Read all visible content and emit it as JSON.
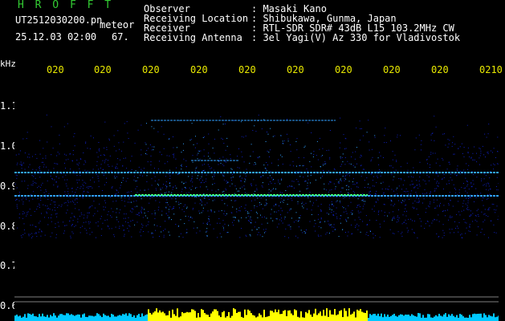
{
  "header": {
    "app_title": "H R O F F T",
    "file_name": "UT2512030200.pn",
    "overlay_label": "meteor",
    "timestamp": "25.12.03 02:00",
    "count": "67.",
    "fields": [
      {
        "label": "Observer",
        "value": ": Masaki Kano"
      },
      {
        "label": "Receiving Location",
        "value": ": Shibukawa, Gunma, Japan"
      },
      {
        "label": "Receiver",
        "value": ": RTL-SDR SDR# 43dB L15 103.2MHz CW"
      },
      {
        "label": "Receiving Antenna",
        "value": ": 3el Yagi(V) Az 330 for Vladivostok"
      }
    ]
  },
  "axes": {
    "y_unit": "kHz",
    "y_ticks": [
      "1.1",
      "1.0",
      "0.9",
      "0.8",
      "0.7",
      "0.6"
    ],
    "x_ticks": [
      "020",
      "020",
      "020",
      "020",
      "020",
      "020",
      "020",
      "020",
      "020",
      "0210"
    ]
  },
  "colors": {
    "background": "#000000",
    "title": "#33cc33",
    "labels": "#ffffff",
    "time_ticks": "#e8e800",
    "signal_low": "#1020c0",
    "signal_mid": "#30a0ff",
    "signal_high": "#40ff80",
    "bottom_bar_cyan": "#00c8ff",
    "bottom_bar_yellow": "#ffff00"
  }
}
